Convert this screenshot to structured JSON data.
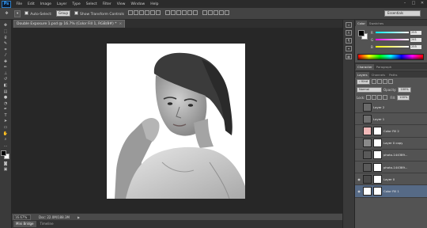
{
  "app": {
    "logo": "Ps",
    "menu": [
      "File",
      "Edit",
      "Image",
      "Layer",
      "Type",
      "Select",
      "Filter",
      "View",
      "Window",
      "Help"
    ],
    "window_controls": [
      "–",
      "□",
      "✕"
    ]
  },
  "options": {
    "auto_select_label": "Auto-Select:",
    "auto_select_value": "Group",
    "transform_label": "Show Transform Controls",
    "workspace": "Essentials"
  },
  "document": {
    "tab_title": "Double Exposure 1.psd @ 16.7% (Color Fill 1, RGB/8#) *",
    "close": "×"
  },
  "status": {
    "zoom": "16.67%",
    "doc": "Doc: 22.0M/188.3M",
    "arrow": "▶"
  },
  "bottom_tabs": [
    "Mini Bridge",
    "Timeline"
  ],
  "icon_strip": [
    "≡",
    "A",
    "¶",
    "✦",
    "▦"
  ],
  "color_panel": {
    "tabs": [
      "Color",
      "Swatches"
    ],
    "channels": [
      {
        "label": "R",
        "value": "255",
        "gradient": "linear-gradient(90deg,#00ffff,#ffffff)"
      },
      {
        "label": "G",
        "value": "241",
        "gradient": "linear-gradient(90deg,#ff00ff,#ffffff)"
      },
      {
        "label": "B",
        "value": "255",
        "gradient": "linear-gradient(90deg,#ffff00,#ffffff)"
      }
    ]
  },
  "char_panel": {
    "tabs": [
      "Character",
      "Paragraph"
    ]
  },
  "layers_panel": {
    "tabs": [
      "Layers",
      "Channels",
      "Paths"
    ],
    "kind": "Kind",
    "blend_mode": "Normal",
    "opacity_label": "Opacity:",
    "opacity": "100%",
    "lock_label": "Lock:",
    "fill_label": "Fill:",
    "fill": "100%",
    "layers": [
      {
        "name": "Layer 2",
        "thumb": "#6a6a6a",
        "mask": false,
        "eye": false
      },
      {
        "name": "Layer 1",
        "thumb": "#707070",
        "mask": false,
        "eye": false
      },
      {
        "name": "Color Fill 2",
        "thumb": "#f1b9b9",
        "mask": true,
        "eye": false
      },
      {
        "name": "Layer 0 copy",
        "thumb": "#8a8a8a",
        "mask": true,
        "eye": false
      },
      {
        "name": "photo-144389...",
        "thumb": "#5a5a5a",
        "mask": true,
        "eye": false
      },
      {
        "name": "photo-144389...",
        "thumb": "#5a5a5a",
        "mask": true,
        "eye": false
      },
      {
        "name": "Layer 0",
        "thumb": "#4a4a4a",
        "mask": true,
        "eye": true
      },
      {
        "name": "Color Fill 1",
        "thumb": "#ffffff",
        "mask": true,
        "eye": true,
        "selected": true
      }
    ]
  }
}
